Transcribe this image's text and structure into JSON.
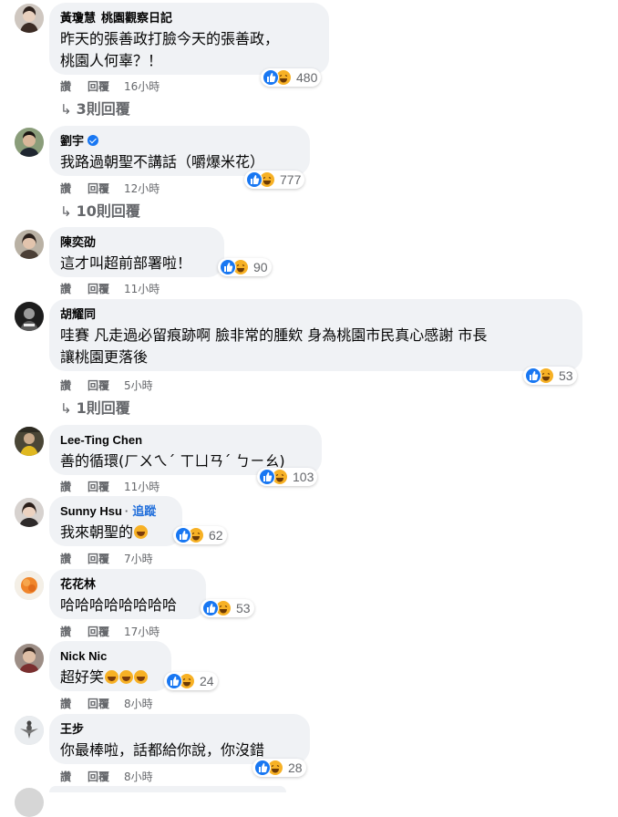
{
  "action_labels": {
    "like": "讚",
    "reply": "回覆"
  },
  "colors": {
    "bubble": "#f0f2f5",
    "like_blue": "#1877f2",
    "haha_yellow": "#f7b125",
    "meta_gray": "#65676b",
    "follow_blue": "#216fdb"
  },
  "comments": [
    {
      "author": "黃瓊慧",
      "author_sub": "桃園觀察日記",
      "text": "昨天的張善政打臉今天的張善政，\n桃園人何辜？！",
      "reactions": "480",
      "time": "16小時",
      "replies": "3則回覆"
    },
    {
      "author": "劉宇",
      "verified": true,
      "text": "我路過朝聖不講話（嚼爆米花）",
      "reactions": "777",
      "time": "12小時",
      "replies": "10則回覆"
    },
    {
      "author": "陳奕劭",
      "text": "這才叫超前部署啦！",
      "reactions": "90",
      "time": "11小時"
    },
    {
      "author": "胡耀同",
      "text": "哇賽 凡走過必留痕跡啊 臉非常的腫欸 身為桃園市民真心感謝 市長\n讓桃園更落後",
      "reactions": "53",
      "time": "5小時",
      "replies": "1則回覆"
    },
    {
      "author": "Lee-Ting Chen",
      "text": "善的循環(ㄏㄨㄟˊ ㄒㄩㄢˊ ㄅㄧㄠ)",
      "reactions": "103",
      "time": "11小時"
    },
    {
      "author": "Sunny Hsu",
      "follow": "追蹤",
      "text": "我來朝聖的",
      "text_emoji_count": 1,
      "reactions": "62",
      "time": "7小時"
    },
    {
      "author": "花花林",
      "text": "哈哈哈哈哈哈哈哈",
      "reactions": "53",
      "time": "17小時"
    },
    {
      "author": "Nick Nic",
      "text": "超好笑",
      "text_emoji_count": 3,
      "reactions": "24",
      "time": "8小時"
    },
    {
      "author": "王步",
      "text": "你最棒啦，話都給你說，你沒錯",
      "reactions": "28",
      "time": "8小時"
    }
  ],
  "icons": {
    "like": "thumbs-up-icon",
    "haha": "laughing-face-icon",
    "reply_arrow": "reply-arrow-icon",
    "verified": "verified-badge-icon"
  }
}
